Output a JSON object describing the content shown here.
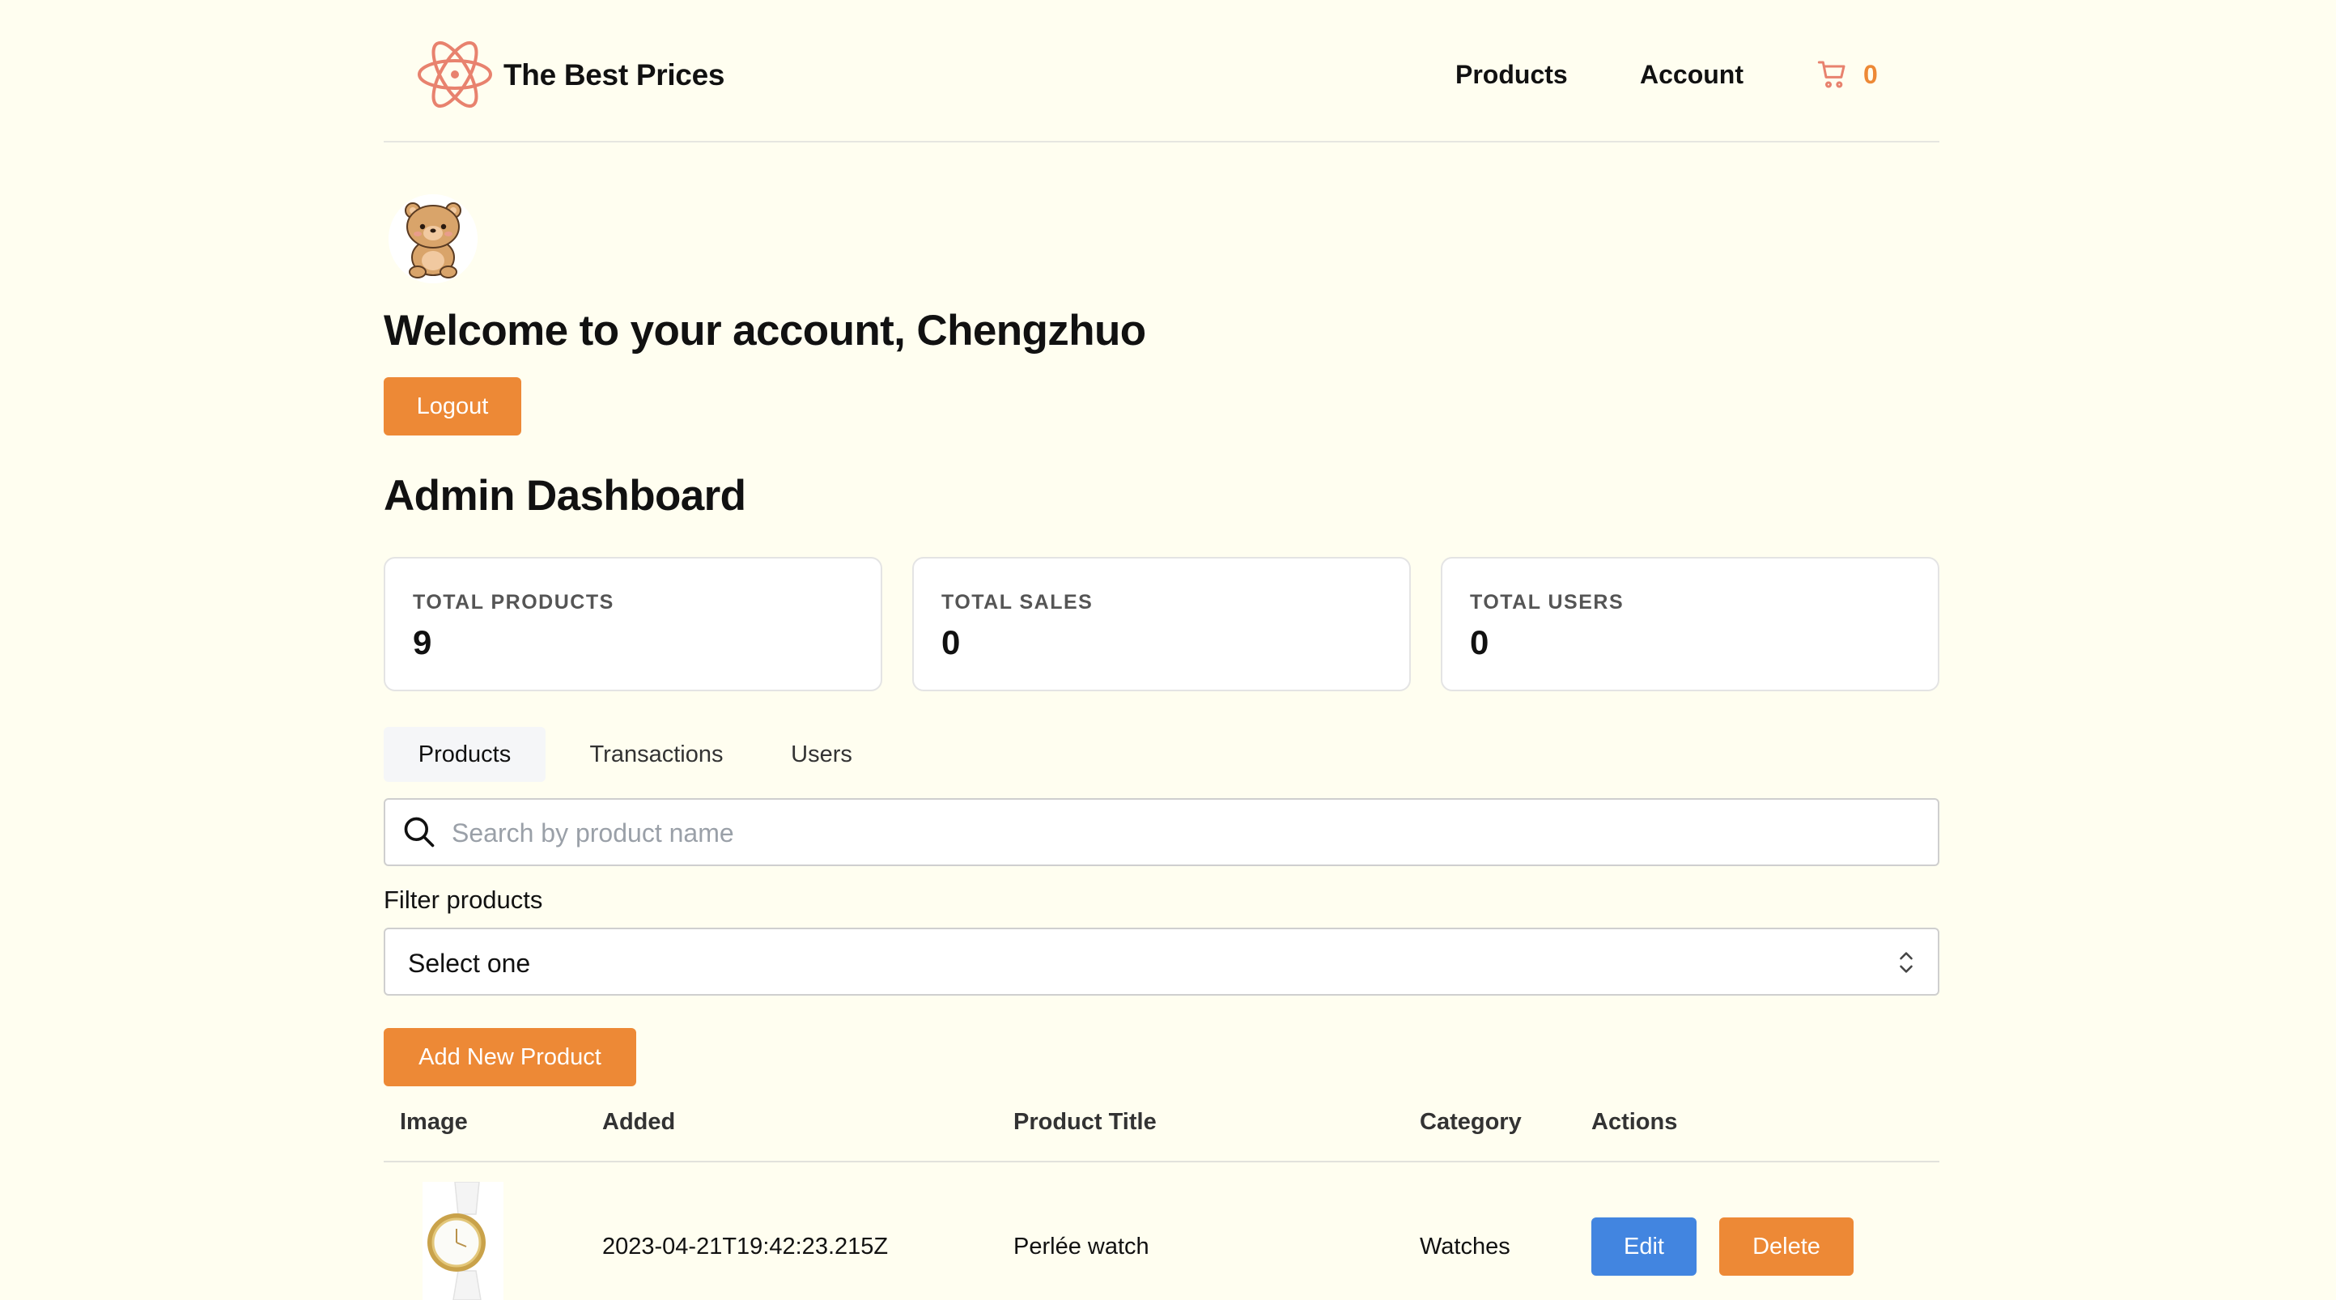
{
  "header": {
    "brand": "The Best Prices",
    "nav": {
      "products": "Products",
      "account": "Account"
    },
    "cart_count": "0"
  },
  "account": {
    "welcome": "Welcome to your account, Chengzhuo",
    "logout_label": "Logout"
  },
  "dashboard": {
    "title": "Admin Dashboard",
    "stats": [
      {
        "label": "TOTAL PRODUCTS",
        "value": "9"
      },
      {
        "label": "TOTAL SALES",
        "value": "0"
      },
      {
        "label": "TOTAL USERS",
        "value": "0"
      }
    ],
    "tabs": [
      {
        "label": "Products",
        "active": true
      },
      {
        "label": "Transactions",
        "active": false
      },
      {
        "label": "Users",
        "active": false
      }
    ],
    "search": {
      "placeholder": "Search by product name",
      "value": ""
    },
    "filter": {
      "label": "Filter products",
      "selected": "Select one"
    },
    "add_button_label": "Add New Product",
    "table": {
      "columns": [
        "Image",
        "Added",
        "Product Title",
        "Category",
        "Actions"
      ],
      "rows": [
        {
          "image": "watch-thumbnail",
          "added": "2023-04-21T19:42:23.215Z",
          "title": "Perlée watch",
          "category": "Watches",
          "edit_label": "Edit",
          "delete_label": "Delete"
        }
      ]
    }
  },
  "colors": {
    "background": "#fffef0",
    "accent_orange": "#ed8936",
    "accent_blue": "#4285e0",
    "logo": "#e8826e"
  },
  "icons": [
    "atom-logo-icon",
    "cart-icon",
    "teddy-bear-avatar",
    "search-icon",
    "chevron-updown-icon"
  ]
}
